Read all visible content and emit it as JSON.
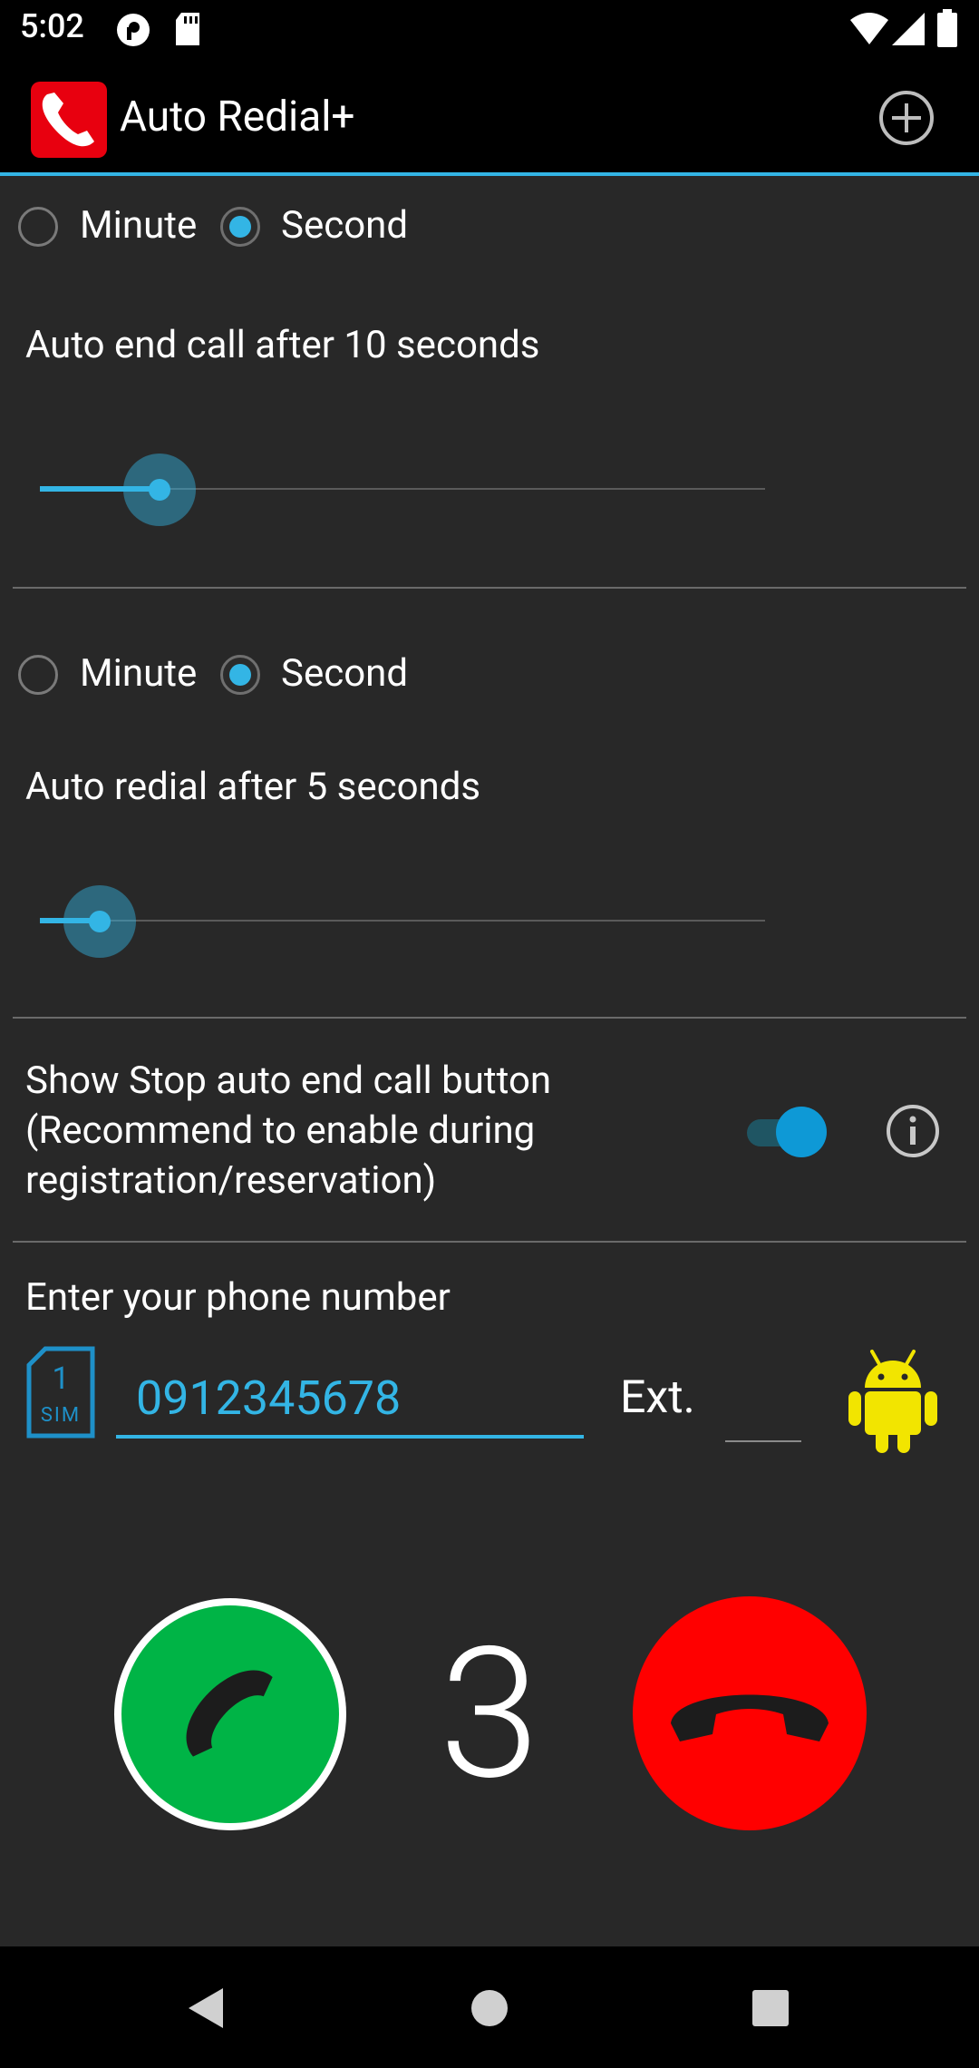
{
  "status_bar": {
    "time": "5:02"
  },
  "app": {
    "title": "Auto Redial+",
    "brand_color": "#e8000f",
    "accent_color": "#33b5e5"
  },
  "end_call_section": {
    "unit_options": [
      "Minute",
      "Second"
    ],
    "selected_unit": "Second",
    "description": "Auto end call after 10 seconds",
    "slider_level": 0.17
  },
  "redial_section": {
    "unit_options": [
      "Minute",
      "Second"
    ],
    "selected_unit": "Second",
    "description": "Auto redial after 5 seconds",
    "slider_level": 0.08
  },
  "stop_button_setting": {
    "line1": "Show Stop auto end call button",
    "line2": "(Recommend to enable during",
    "line3": "registration/reservation)",
    "enabled": true
  },
  "phone": {
    "label": "Enter your phone number",
    "sim_number": "1",
    "sim_label": "SIM",
    "value": "0912345678",
    "ext_label": "Ext.",
    "ext_value": ""
  },
  "call_controls": {
    "counter": "3",
    "call_color": "#00b446",
    "end_color": "#ff0000"
  },
  "icons": [
    "app-phone-icon",
    "add-circle-icon",
    "info-icon",
    "sim-card-icon",
    "android-icon",
    "phone-icon",
    "hang-up-icon",
    "back-icon",
    "home-icon",
    "recents-icon"
  ]
}
